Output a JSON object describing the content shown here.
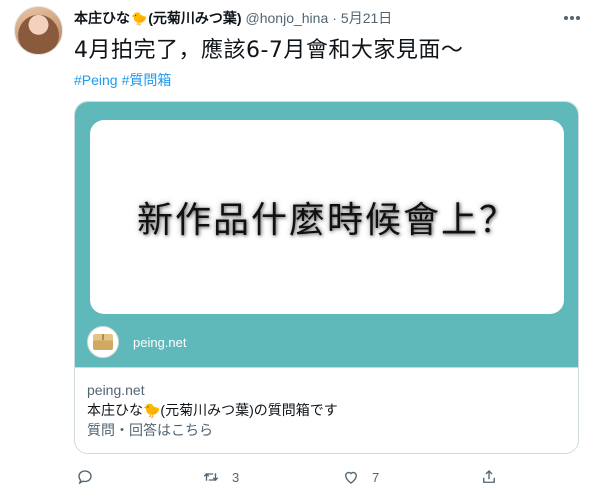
{
  "tweet": {
    "display_name": "本庄ひな",
    "name_emoji": "🐤",
    "name_suffix": "(元菊川みつ葉)",
    "handle": "@honjo_hina",
    "separator": "·",
    "date": "5月21日",
    "text": "4月拍完了，應該6-7月會和大家見面～",
    "hashtags": [
      "#Peing",
      "#質問箱"
    ]
  },
  "card": {
    "question": "新作品什麼時候會上？",
    "image_domain": "peing.net",
    "domain": "peing.net",
    "title": "本庄ひな🐤(元菊川みつ葉)の質問箱です",
    "description": "質問・回答はこちら",
    "colors": {
      "teal": "#5fb8b9",
      "border": "#cfd9de"
    }
  },
  "actions": {
    "reply_count": "",
    "retweet_count": "3",
    "like_count": "7"
  },
  "icons": [
    "more-icon",
    "reply-icon",
    "retweet-icon",
    "like-icon",
    "share-icon"
  ],
  "colors": {
    "link": "#1d9bf0",
    "muted": "#536471",
    "text": "#0f1419"
  }
}
